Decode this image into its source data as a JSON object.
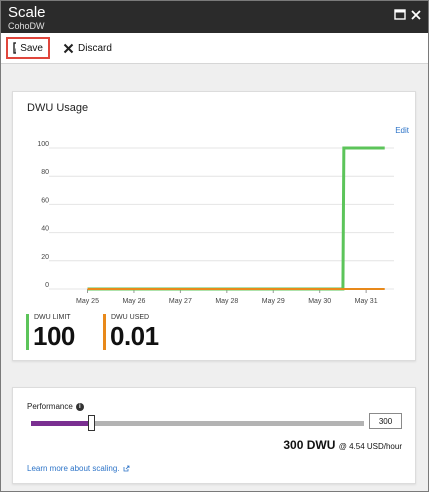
{
  "window": {
    "title": "Scale",
    "subtitle": "CohoDW"
  },
  "toolbar": {
    "save_label": "Save",
    "discard_label": "Discard"
  },
  "usage_card": {
    "title": "DWU Usage",
    "edit_label": "Edit"
  },
  "chart_data": {
    "type": "line",
    "title": "DWU Usage",
    "xlabel": "",
    "ylabel": "",
    "ylim": [
      0,
      100
    ],
    "yticks": [
      0,
      20,
      40,
      60,
      80,
      100
    ],
    "xticks": [
      "May 25",
      "May 26",
      "May 27",
      "May 28",
      "May 29",
      "May 30",
      "May 31"
    ],
    "x": [
      0,
      5.5,
      5.52,
      6.4
    ],
    "series": [
      {
        "name": "DWU LIMIT",
        "color": "#5cc45a",
        "values": [
          0,
          0,
          100,
          100
        ]
      },
      {
        "name": "DWU USED",
        "color": "#e8891a",
        "values": [
          0,
          0,
          0.01,
          0.01
        ]
      }
    ],
    "grid": true
  },
  "metrics": [
    {
      "label": "DWU LIMIT",
      "value": "100",
      "color": "#5cc45a"
    },
    {
      "label": "DWU USED",
      "value": "0.01",
      "color": "#e8891a"
    }
  ],
  "performance": {
    "label": "Performance",
    "slider_fraction": 0.18,
    "input_value": "300",
    "summary_main": "300 DWU",
    "summary_cost": "@ 4.54 USD/hour",
    "slider_colors": {
      "filled": "#7a2f91",
      "track": "#b3b3b3"
    },
    "learn_more": "Learn more about scaling."
  },
  "icons": [
    "maximize-icon",
    "close-icon",
    "save-icon",
    "discard-icon",
    "info-icon",
    "external-link-icon"
  ]
}
